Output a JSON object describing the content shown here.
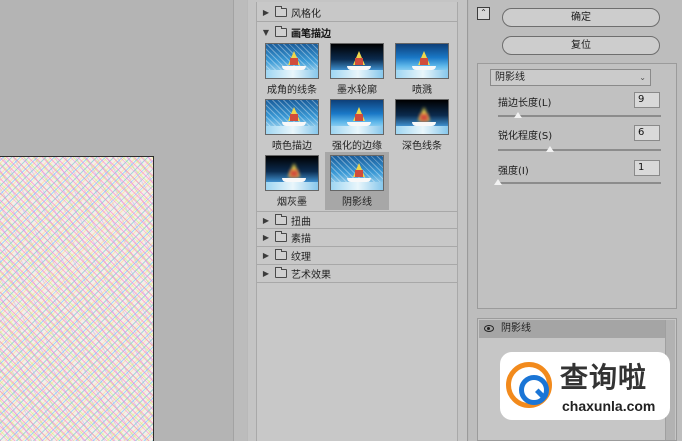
{
  "gallery": {
    "categories": [
      {
        "label": "风格化",
        "expanded": false
      },
      {
        "label": "画笔描边",
        "expanded": true
      },
      {
        "label": "扭曲",
        "expanded": false
      },
      {
        "label": "素描",
        "expanded": false
      },
      {
        "label": "纹理",
        "expanded": false
      },
      {
        "label": "艺术效果",
        "expanded": false
      }
    ],
    "thumbnails": [
      {
        "label": "成角的线条"
      },
      {
        "label": "墨水轮廓"
      },
      {
        "label": "喷溅"
      },
      {
        "label": "喷色描边"
      },
      {
        "label": "强化的边缘"
      },
      {
        "label": "深色线条"
      },
      {
        "label": "烟灰墨"
      },
      {
        "label": "阴影线",
        "selected": true
      }
    ]
  },
  "buttons": {
    "ok_label": "确定",
    "reset_label": "复位"
  },
  "settings": {
    "selected_filter": "阴影线",
    "params": [
      {
        "label": "描边长度(L)",
        "value": "9",
        "slider_fraction": 0.12
      },
      {
        "label": "锐化程度(S)",
        "value": "6",
        "slider_fraction": 0.32
      },
      {
        "label": "强度(I)",
        "value": "1",
        "slider_fraction": 0.0
      }
    ]
  },
  "layers": {
    "items": [
      {
        "name": "阴影线",
        "visible": true
      }
    ]
  },
  "watermark": {
    "title": "查询啦",
    "domain": "chaxunla.com"
  },
  "colors": {
    "panel_bg": "#bdbdbd",
    "selected_thumb_bg": "#a7a7a7",
    "watermark_orange": "#f28a1c",
    "watermark_blue": "#1a75d6"
  }
}
